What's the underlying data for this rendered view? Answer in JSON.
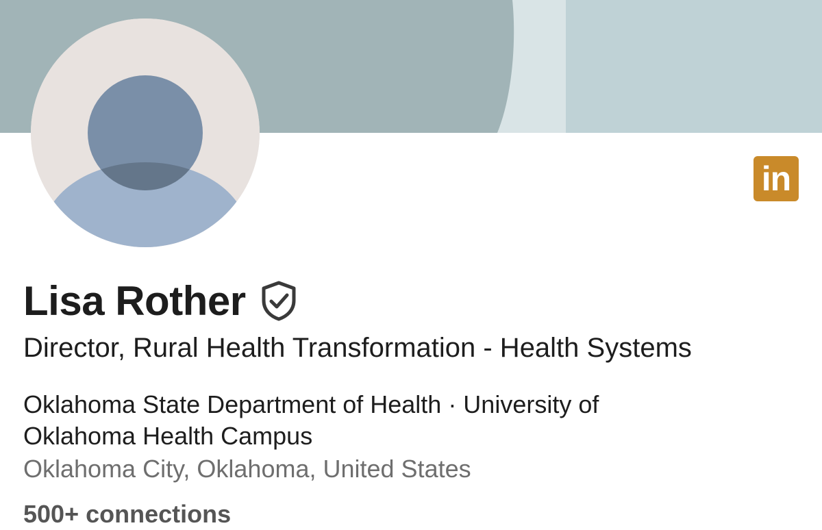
{
  "profile": {
    "name": "Lisa Rother",
    "headline": "Director, Rural Health Transformation - Health Systems",
    "organizations": "Oklahoma State Department of Health · University of Oklahoma Health Campus",
    "location": "Oklahoma City, Oklahoma, United States",
    "connections": "500+ connections"
  },
  "badges": {
    "linkedin_label": "in",
    "verified_icon": "shield-check-icon"
  },
  "colors": {
    "banner_dark": "#a1b4b7",
    "banner_light": "#bfd2d6",
    "banner_stripe": "#d9e4e6",
    "avatar_bg": "#e8e2df",
    "avatar_head": "#7a8fa8",
    "avatar_body": "#9fb3cc",
    "linkedin_badge": "#c98a2a",
    "text_primary": "#1d1d1d",
    "text_secondary": "#6e6e6e"
  }
}
